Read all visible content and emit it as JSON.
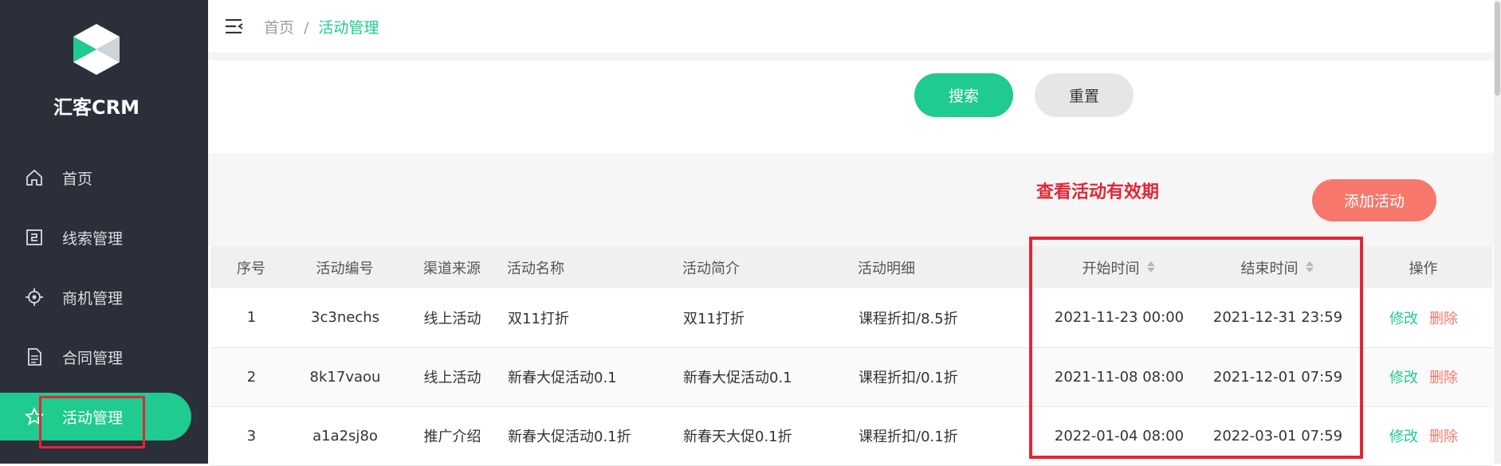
{
  "app": {
    "brand": "汇客CRM"
  },
  "sidebar": {
    "items": [
      {
        "label": "首页",
        "icon": "home-icon"
      },
      {
        "label": "线索管理",
        "icon": "clue-icon"
      },
      {
        "label": "商机管理",
        "icon": "target-icon"
      },
      {
        "label": "合同管理",
        "icon": "document-icon"
      },
      {
        "label": "活动管理",
        "icon": "star-icon",
        "active": true
      }
    ]
  },
  "header": {
    "breadcrumb": [
      "首页",
      "活动管理"
    ],
    "separator": "/"
  },
  "search": {
    "search_label": "搜索",
    "reset_label": "重置"
  },
  "toolbar": {
    "annotation": "查看活动有效期",
    "add_label": "添加活动"
  },
  "table": {
    "columns": [
      "序号",
      "活动编号",
      "渠道来源",
      "活动名称",
      "活动简介",
      "活动明细",
      "开始时间",
      "结束时间",
      "操作"
    ],
    "rows": [
      {
        "no": "1",
        "code": "3c3nechs",
        "channel": "线上活动",
        "name": "双11打折",
        "intro": "双11打折",
        "detail": "课程折扣/8.5折",
        "start": "2021-11-23 00:00",
        "end": "2021-12-31 23:59"
      },
      {
        "no": "2",
        "code": "8k17vaou",
        "channel": "线上活动",
        "name": "新春大促活动0.1",
        "intro": "新春大促活动0.1",
        "detail": "课程折扣/0.1折",
        "start": "2021-11-08 08:00",
        "end": "2021-12-01 07:59"
      },
      {
        "no": "3",
        "code": "a1a2sj8o",
        "channel": "推广介绍",
        "name": "新春大促活动0.1折",
        "intro": "新春天大促0.1折",
        "detail": "课程折扣/0.1折",
        "start": "2022-01-04 08:00",
        "end": "2022-03-01 07:59"
      }
    ],
    "edit_label": "修改",
    "delete_label": "删除"
  },
  "colors": {
    "accent": "#1fcb8e",
    "danger": "#f7786b",
    "annotation": "#e32636",
    "sidebar_bg": "#2b2f3a"
  }
}
